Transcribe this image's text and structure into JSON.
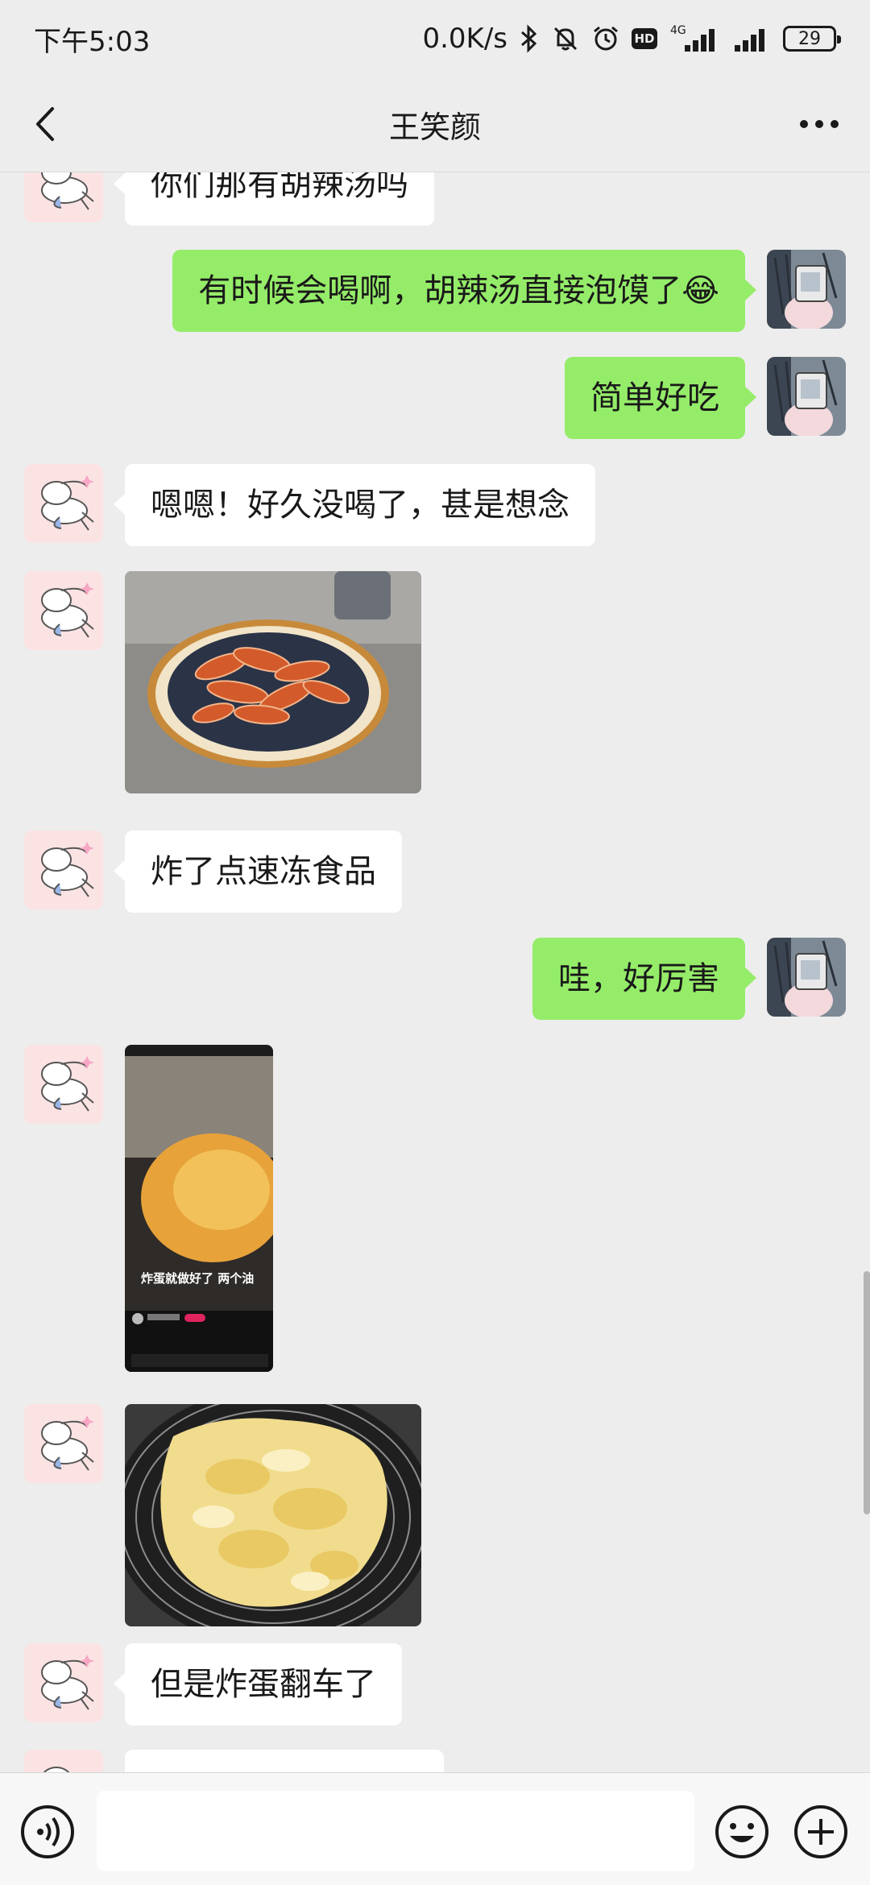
{
  "status_bar": {
    "time": "下午5:03",
    "network_speed": "0.0K/s",
    "network_type": "4G",
    "hd_label": "HD",
    "battery": "29"
  },
  "header": {
    "title": "王笑颜"
  },
  "messages": [
    {
      "side": "left",
      "type": "text",
      "text": "你们那有胡辣汤吗"
    },
    {
      "side": "right",
      "type": "text",
      "text": "有时候会喝啊，胡辣汤直接泡馍了😂"
    },
    {
      "side": "right",
      "type": "text",
      "text": "简单好吃"
    },
    {
      "side": "left",
      "type": "text",
      "text": "嗯嗯！好久没喝了，甚是想念"
    },
    {
      "side": "left",
      "type": "image",
      "image": "fried-chicken-photo"
    },
    {
      "side": "left",
      "type": "text",
      "text": "炸了点速冻食品"
    },
    {
      "side": "right",
      "type": "text",
      "text": "哇，好厉害"
    },
    {
      "side": "left",
      "type": "image",
      "image": "video-screenshot",
      "overlay_text": "炸蛋就做好了 两个油"
    },
    {
      "side": "left",
      "type": "image",
      "image": "fried-egg-photo"
    },
    {
      "side": "left",
      "type": "text",
      "text": "但是炸蛋翻车了"
    }
  ],
  "input_bar": {
    "placeholder": "",
    "voice_icon": "voice-icon",
    "emoji_icon": "emoji-icon",
    "plus_icon": "plus-icon"
  },
  "colors": {
    "background": "#ededed",
    "bubble_self": "#95ec69",
    "bubble_other": "#ffffff"
  }
}
